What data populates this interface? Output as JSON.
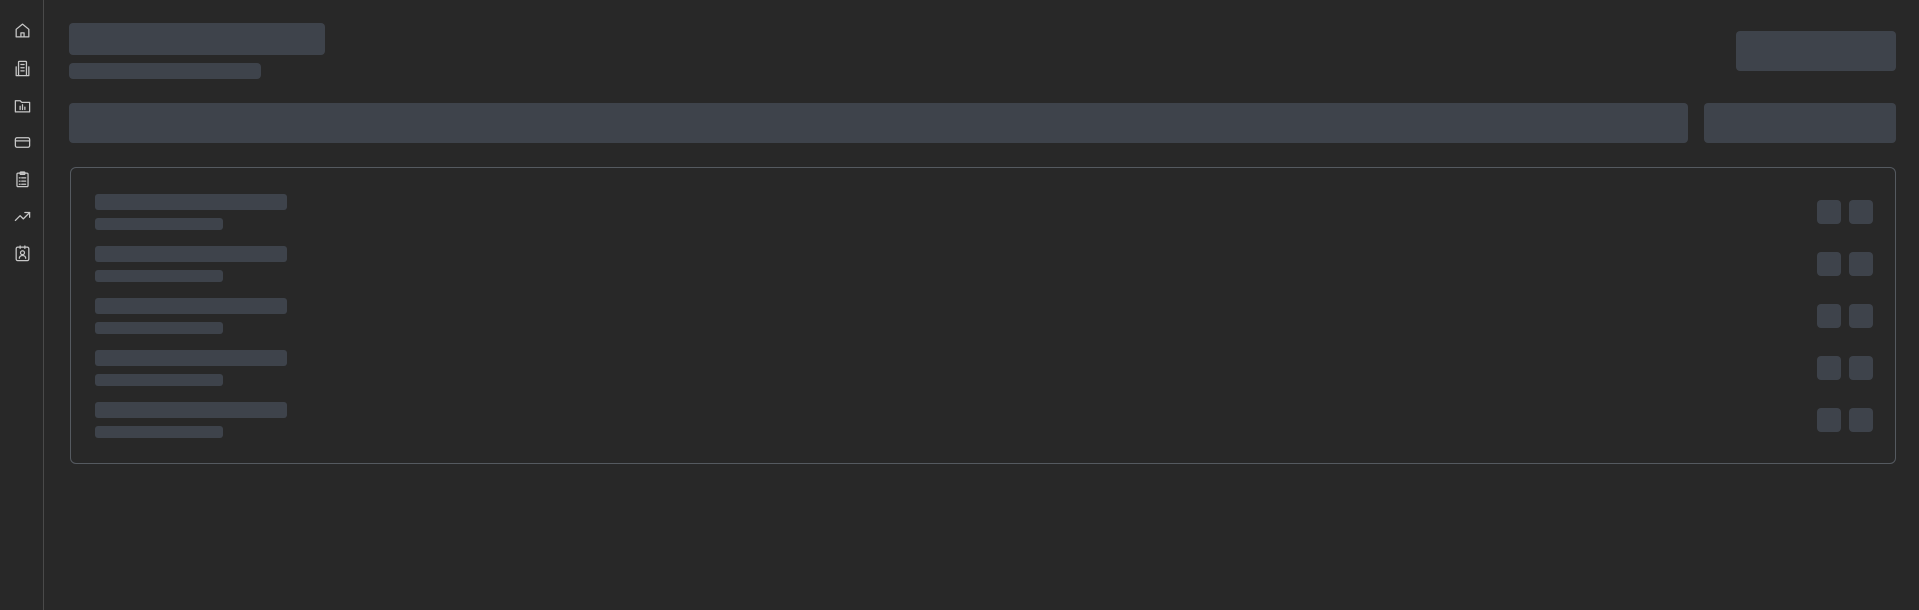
{
  "sidebar": {
    "items": [
      {
        "icon": "home-icon"
      },
      {
        "icon": "building-icon"
      },
      {
        "icon": "folder-chart-icon"
      },
      {
        "icon": "credit-card-icon"
      },
      {
        "icon": "clipboard-list-icon"
      },
      {
        "icon": "trending-up-icon"
      },
      {
        "icon": "contact-badge-icon"
      }
    ]
  },
  "state": "loading-skeleton",
  "list": {
    "placeholder_rows": 5,
    "actions_per_row": 2
  },
  "colors": {
    "background": "#282828",
    "skeleton": "#3e434b",
    "border": "#555a60",
    "icon": "#c8c8c8"
  }
}
